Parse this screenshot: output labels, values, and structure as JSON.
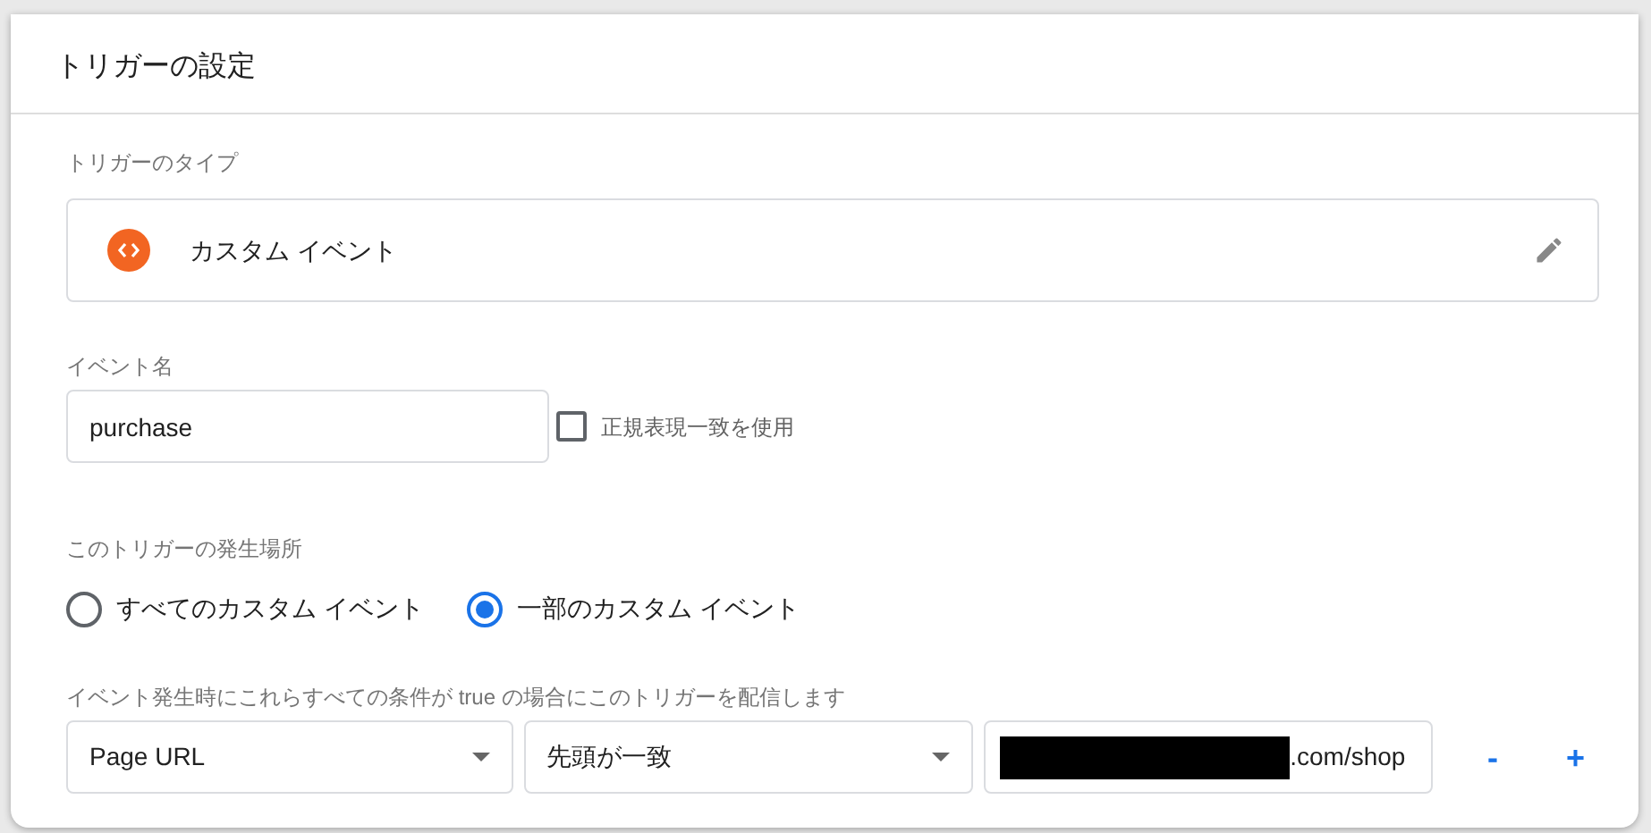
{
  "card": {
    "title": "トリガーの設定"
  },
  "trigger_type": {
    "label": "トリガーのタイプ",
    "name": "カスタム イベント"
  },
  "event_name": {
    "label": "イベント名",
    "value": "purchase",
    "regex": {
      "label": "正規表現一致を使用",
      "checked": false
    }
  },
  "scope": {
    "label": "このトリガーの発生場所",
    "options": [
      {
        "label": "すべてのカスタム イベント",
        "selected": false
      },
      {
        "label": "一部のカスタム イベント",
        "selected": true
      }
    ]
  },
  "conditions": {
    "label": "イベント発生時にこれらすべての条件が true の場合にこのトリガーを配信します",
    "rows": [
      {
        "variable": "Page URL",
        "operator": "先頭が一致",
        "value": ".com/shop",
        "redacted": true,
        "remove": "-",
        "add": "+"
      }
    ]
  }
}
